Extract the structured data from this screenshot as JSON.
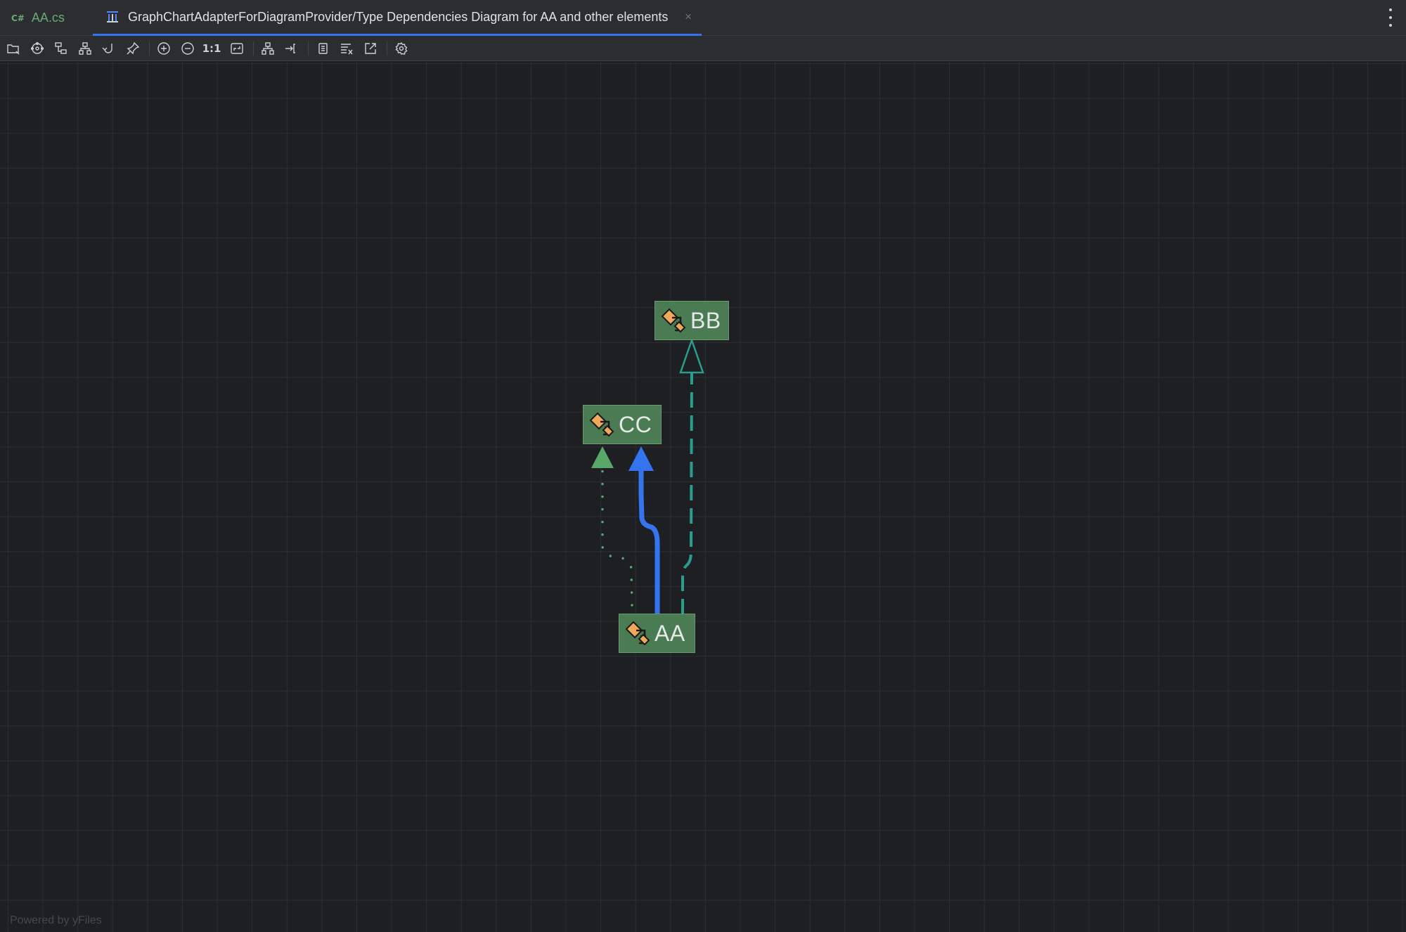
{
  "tabs": [
    {
      "lang": "C#",
      "label": "AA.cs"
    },
    {
      "label": "GraphChartAdapterForDiagramProvider/Type Dependencies Diagram for AA and other elements",
      "close": "×"
    }
  ],
  "toolbar": {
    "zoom_actual_label": "1:1",
    "icons": [
      "open-icon",
      "layout-circular-icon",
      "layout-tree-icon",
      "layout-hierarchy-icon",
      "route-edges-icon",
      "pin-icon",
      "zoom-in-icon",
      "zoom-out-icon",
      "actual-size-icon",
      "fit-content-icon",
      "apply-layout-icon",
      "export-icon",
      "copy-icon",
      "filter-icon",
      "open-in-window-icon",
      "settings-icon"
    ]
  },
  "diagram": {
    "nodes": [
      {
        "label": "BB",
        "icon": "class-icon"
      },
      {
        "label": "CC",
        "icon": "class-icon"
      },
      {
        "label": "AA",
        "icon": "class-icon"
      }
    ],
    "edges": [
      {
        "from": "AA",
        "to": "CC",
        "style": "dotted",
        "color": "#59a869"
      },
      {
        "from": "AA",
        "to": "CC",
        "style": "solid",
        "color": "#3574f0"
      },
      {
        "from": "AA",
        "to": "BB",
        "style": "dashed",
        "color": "#2a9d8f"
      }
    ]
  },
  "watermark": "Powered by yFiles"
}
